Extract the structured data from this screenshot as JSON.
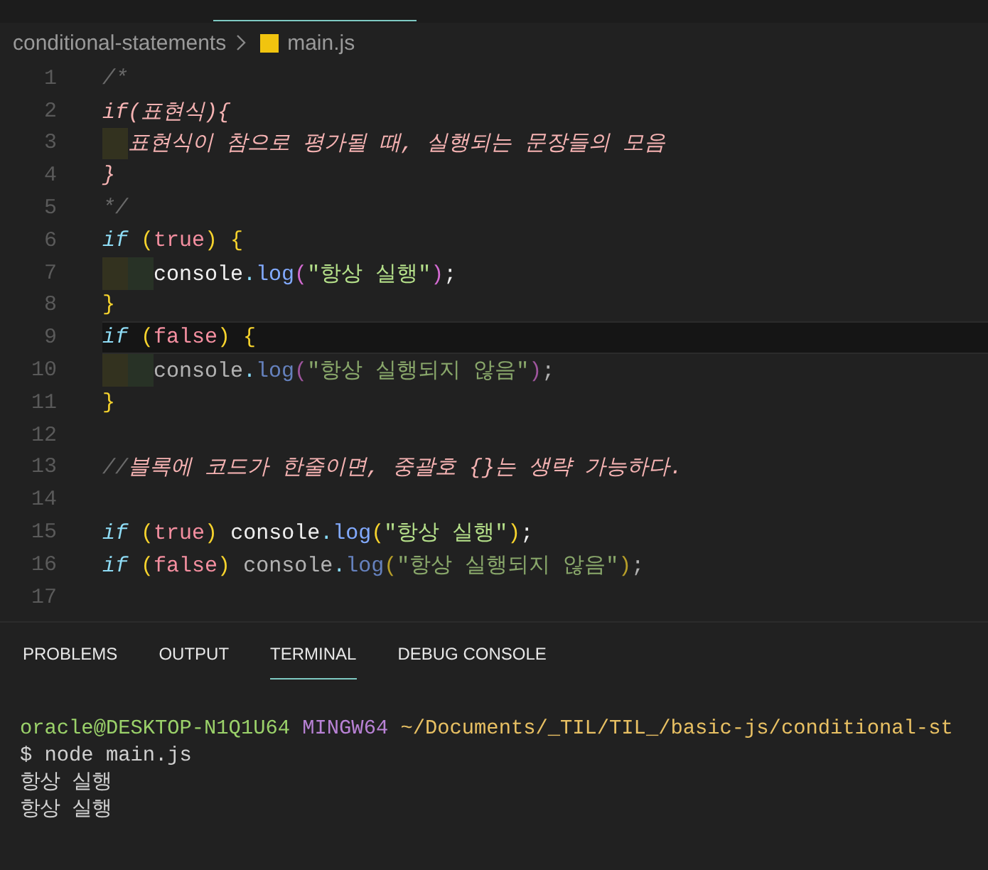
{
  "breadcrumb": {
    "folder": "conditional-statements",
    "file": "main.js"
  },
  "editor": {
    "lines": [
      {
        "number": "1",
        "selected": false,
        "tokens": [
          {
            "kind": "comment",
            "text": "/*"
          }
        ]
      },
      {
        "number": "2",
        "selected": false,
        "tokens": [
          {
            "kind": "comment-text",
            "text": "if(표현식){"
          }
        ]
      },
      {
        "number": "3",
        "selected": false,
        "tokens": [
          {
            "kind": "indent1"
          },
          {
            "kind": "comment-text",
            "text": "표현식이 참으로 평가될 때, 실행되는 문장들의 모음"
          }
        ]
      },
      {
        "number": "4",
        "selected": false,
        "tokens": [
          {
            "kind": "comment-text",
            "text": "}"
          }
        ]
      },
      {
        "number": "5",
        "selected": false,
        "tokens": [
          {
            "kind": "comment",
            "text": "*/"
          }
        ]
      },
      {
        "number": "6",
        "selected": false,
        "tokens": [
          {
            "kind": "keyword",
            "text": "if"
          },
          {
            "kind": "paren",
            "text": " ("
          },
          {
            "kind": "literal",
            "text": "true"
          },
          {
            "kind": "paren",
            "text": ") {"
          }
        ]
      },
      {
        "number": "7",
        "selected": false,
        "tokens": [
          {
            "kind": "indent1"
          },
          {
            "kind": "indent2"
          },
          {
            "kind": "plain",
            "text": "console"
          },
          {
            "kind": "dot",
            "text": "."
          },
          {
            "kind": "method",
            "text": "log"
          },
          {
            "kind": "paren2",
            "text": "("
          },
          {
            "kind": "string",
            "text": "\"항상 실행\""
          },
          {
            "kind": "paren2",
            "text": ")"
          },
          {
            "kind": "plain",
            "text": ";"
          }
        ]
      },
      {
        "number": "8",
        "selected": false,
        "tokens": [
          {
            "kind": "paren",
            "text": "}"
          }
        ]
      },
      {
        "number": "9",
        "selected": true,
        "tokens": [
          {
            "kind": "keyword",
            "text": "if"
          },
          {
            "kind": "paren",
            "text": " ("
          },
          {
            "kind": "literal",
            "text": "false"
          },
          {
            "kind": "paren",
            "text": ") {"
          }
        ]
      },
      {
        "number": "10",
        "selected": false,
        "tokens": [
          {
            "kind": "indent1"
          },
          {
            "kind": "indent2"
          },
          {
            "kind": "plain-dim",
            "text": "console"
          },
          {
            "kind": "dot",
            "text": "."
          },
          {
            "kind": "method-dim",
            "text": "log"
          },
          {
            "kind": "paren2-dim",
            "text": "("
          },
          {
            "kind": "string-dim",
            "text": "\"항상 실행되지 않음\""
          },
          {
            "kind": "paren2-dim",
            "text": ")"
          },
          {
            "kind": "plain-dim",
            "text": ";"
          }
        ]
      },
      {
        "number": "11",
        "selected": false,
        "tokens": [
          {
            "kind": "paren",
            "text": "}"
          }
        ]
      },
      {
        "number": "12",
        "selected": false
      },
      {
        "number": "13",
        "selected": false,
        "tokens": [
          {
            "kind": "comment",
            "text": "//"
          },
          {
            "kind": "comment-text",
            "text": "블록에 코드가 한줄이면, 중괄호 {}는 생략 가능하다."
          }
        ]
      },
      {
        "number": "14",
        "selected": false
      },
      {
        "number": "15",
        "selected": false,
        "tokens": [
          {
            "kind": "keyword",
            "text": "if"
          },
          {
            "kind": "paren",
            "text": " ("
          },
          {
            "kind": "literal",
            "text": "true"
          },
          {
            "kind": "paren",
            "text": ")"
          },
          {
            "kind": "plain",
            "text": " console"
          },
          {
            "kind": "dot",
            "text": "."
          },
          {
            "kind": "method",
            "text": "log"
          },
          {
            "kind": "paren",
            "text": "("
          },
          {
            "kind": "string",
            "text": "\"항상 실행\""
          },
          {
            "kind": "paren",
            "text": ")"
          },
          {
            "kind": "plain",
            "text": ";"
          }
        ]
      },
      {
        "number": "16",
        "selected": false,
        "tokens": [
          {
            "kind": "keyword",
            "text": "if"
          },
          {
            "kind": "paren",
            "text": " ("
          },
          {
            "kind": "literal",
            "text": "false"
          },
          {
            "kind": "paren",
            "text": ")"
          },
          {
            "kind": "plain-dim",
            "text": " console"
          },
          {
            "kind": "dot",
            "text": "."
          },
          {
            "kind": "method-dim",
            "text": "log"
          },
          {
            "kind": "paren-dim",
            "text": "("
          },
          {
            "kind": "string-dim",
            "text": "\"항상 실행되지 않음\""
          },
          {
            "kind": "paren-dim",
            "text": ")"
          },
          {
            "kind": "plain-dim",
            "text": ";"
          }
        ]
      },
      {
        "number": "17",
        "selected": false
      }
    ]
  },
  "panel_tabs": [
    {
      "label": "PROBLEMS",
      "selected": false
    },
    {
      "label": "OUTPUT",
      "selected": false
    },
    {
      "label": "TERMINAL",
      "selected": true
    },
    {
      "label": "DEBUG CONSOLE",
      "selected": false
    }
  ],
  "terminal": {
    "lines": [
      {
        "parts": [
          {
            "kind": "user",
            "text": "oracle@DESKTOP-N1Q1U64"
          },
          {
            "kind": "host",
            "text": " MINGW64"
          },
          {
            "kind": "path",
            "text": " ~/Documents/_TIL/TIL_/basic-js/conditional-st"
          }
        ]
      },
      {
        "parts": [
          {
            "kind": "output",
            "text": "$ node main.js"
          }
        ]
      },
      {
        "parts": [
          {
            "kind": "output",
            "text": "항상 실행"
          }
        ]
      },
      {
        "parts": [
          {
            "kind": "output",
            "text": "항상 실행"
          }
        ]
      }
    ]
  }
}
